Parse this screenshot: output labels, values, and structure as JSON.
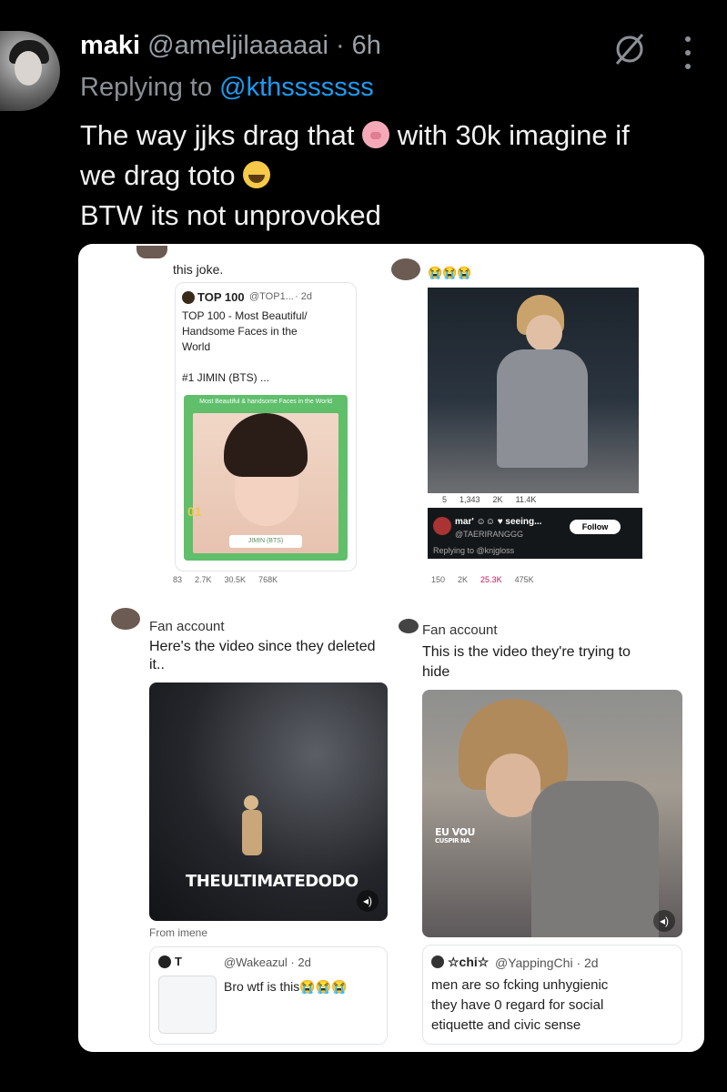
{
  "header": {
    "display_name": "maki",
    "handle": "@ameljilaaaaai",
    "separator": " · ",
    "time": "6h",
    "replying_prefix": "Replying to ",
    "replying_to": "@kthsssssss"
  },
  "tweet": {
    "line1_a": "The way jjks drag that ",
    "line1_b": " with 30k  imagine if",
    "line2": "we drag toto ",
    "line3": "BTW its not unprovoked"
  },
  "icons": {
    "grok": "grok-slash-icon",
    "more": "more-vertical-icon",
    "pig": "pig-face-emoji",
    "cry": "loudly-crying-emoji"
  },
  "media": {
    "top_left": {
      "caption_top": "this joke.",
      "quote_name": "TOP 100",
      "quote_handle": "@TOP1...",
      "quote_time": "· 2d",
      "quote_text_1": "TOP 100 - Most Beautiful/",
      "quote_text_2": "Handsome Faces in the",
      "quote_text_3": "World",
      "quote_text_4": "#1 JIMIN (BTS) ...",
      "frame_caption": "Most Beautiful & handsome Faces in the World",
      "rank": "01",
      "portrait_label": "JIMIN (BTS)",
      "stats": [
        "83",
        "2.7K",
        "30.5K",
        "768K"
      ]
    },
    "top_right": {
      "emoji_row": "😭😭😭",
      "video_stats": [
        "5",
        "1,343",
        "2K",
        "11.4K"
      ],
      "reply_name": "mar' ☺☺ ♥ seeing...",
      "reply_handle": "@TAERIRANGGG",
      "follow": "Follow",
      "replying": "Replying to @knjgloss",
      "stats": [
        "150",
        "2K",
        "25.3K",
        "475K"
      ]
    },
    "bottom_left": {
      "fan_label": "Fan account",
      "text_1": "Here's the video since they deleted",
      "text_2": "it..",
      "watermark": "THEULTIMATEDODO",
      "from_label": "From imene",
      "quote_name": "T",
      "quote_handle": "@Wakeazul · 2d",
      "quote_text": "Bro wtf is this😭😭😭"
    },
    "bottom_right": {
      "fan_label": "Fan account",
      "text_1": "This is the video they're trying to",
      "text_2": "hide",
      "overlay_1": "EU VOU",
      "overlay_2": "CUSPIR NA",
      "quote_name": "☆chi☆",
      "quote_handle": "@YappingChi · 2d",
      "quote_text_1": "men are so fcking unhygienic",
      "quote_text_2": "they have 0 regard for social",
      "quote_text_3": "etiquette and civic sense"
    }
  },
  "colors": {
    "background": "#000000",
    "link": "#1d9bf0",
    "muted": "#8b9096"
  }
}
